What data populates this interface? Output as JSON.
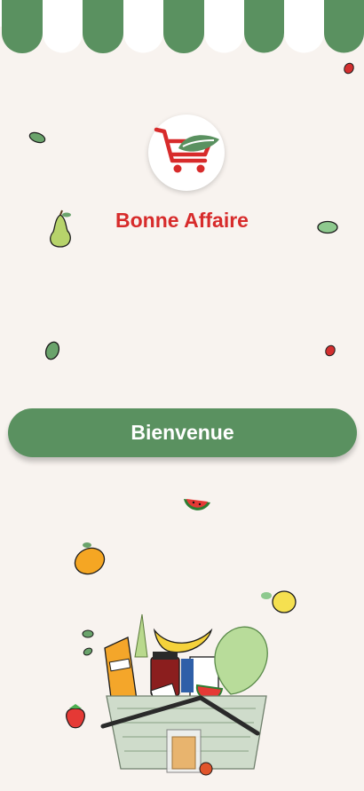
{
  "header": {
    "awning_colors": [
      "#5a9160",
      "#ffffff"
    ],
    "awning_icon": "shop-awning-icon"
  },
  "logo": {
    "icon": "shopping-cart-leaf-icon",
    "cart_color": "#d72b2b",
    "leaf_color": "#5a9160"
  },
  "brand": {
    "name": "Bonne Affaire",
    "color": "#d72b2b"
  },
  "welcome_button": {
    "label": "Bienvenue",
    "background": "#5a9160"
  },
  "decorations": [
    "leaf-icon",
    "cherry-icon",
    "pear-icon",
    "leaf-icon",
    "leaf-icon",
    "cherry-icon",
    "watermelon-slice-icon",
    "mango-icon",
    "lemon-icon",
    "strawberry-icon",
    "leaf-icon",
    "leaf-icon"
  ],
  "illustration": "grocery-basket-illustration"
}
